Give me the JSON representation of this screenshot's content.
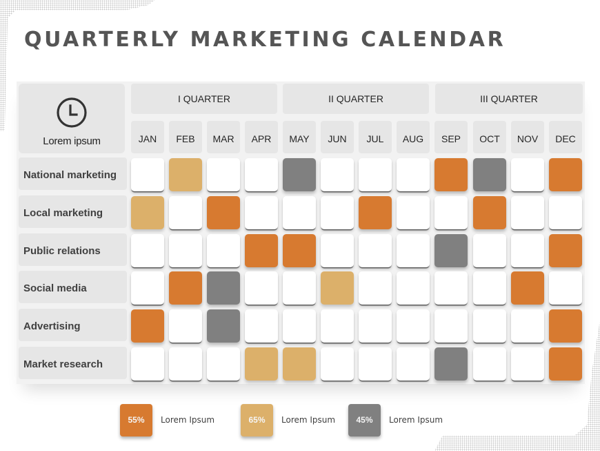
{
  "title": "QUARTERLY MARKETING CALENDAR",
  "corner": {
    "icon": "clock-icon",
    "label": "Lorem ipsum"
  },
  "colors": {
    "orange": "#d77a30",
    "tan": "#dcb06a",
    "gray": "#808080",
    "empty": "#ffffff",
    "header_bg": "#e6e6e6"
  },
  "quarters": [
    "I  QUARTER",
    "II  QUARTER",
    "III  QUARTER"
  ],
  "months": [
    "JAN",
    "FEB",
    "MAR",
    "APR",
    "MAY",
    "JUN",
    "JUL",
    "AUG",
    "SEP",
    "OCT",
    "NOV",
    "DEC"
  ],
  "rows": [
    {
      "label": "National marketing",
      "cells": [
        "empty",
        "tan",
        "empty",
        "empty",
        "gray",
        "empty",
        "empty",
        "empty",
        "orange",
        "gray",
        "empty",
        "orange"
      ]
    },
    {
      "label": "Local marketing",
      "cells": [
        "tan",
        "empty",
        "orange",
        "empty",
        "empty",
        "empty",
        "orange",
        "empty",
        "empty",
        "orange",
        "empty",
        "empty"
      ]
    },
    {
      "label": "Public relations",
      "cells": [
        "empty",
        "empty",
        "empty",
        "orange",
        "orange",
        "empty",
        "empty",
        "empty",
        "gray",
        "empty",
        "empty",
        "orange"
      ]
    },
    {
      "label": "Social media",
      "cells": [
        "empty",
        "orange",
        "gray",
        "empty",
        "empty",
        "tan",
        "empty",
        "empty",
        "empty",
        "empty",
        "orange",
        "empty"
      ]
    },
    {
      "label": "Advertising",
      "cells": [
        "orange",
        "empty",
        "gray",
        "empty",
        "empty",
        "empty",
        "empty",
        "empty",
        "empty",
        "empty",
        "empty",
        "orange"
      ]
    },
    {
      "label": "Market research",
      "cells": [
        "empty",
        "empty",
        "empty",
        "tan",
        "tan",
        "empty",
        "empty",
        "empty",
        "gray",
        "empty",
        "empty",
        "orange"
      ]
    }
  ],
  "legend": [
    {
      "color": "orange",
      "value": "55%",
      "label": "Lorem Ipsum"
    },
    {
      "color": "tan",
      "value": "65%",
      "label": "Lorem Ipsum"
    },
    {
      "color": "gray",
      "value": "45%",
      "label": "Lorem Ipsum"
    }
  ]
}
